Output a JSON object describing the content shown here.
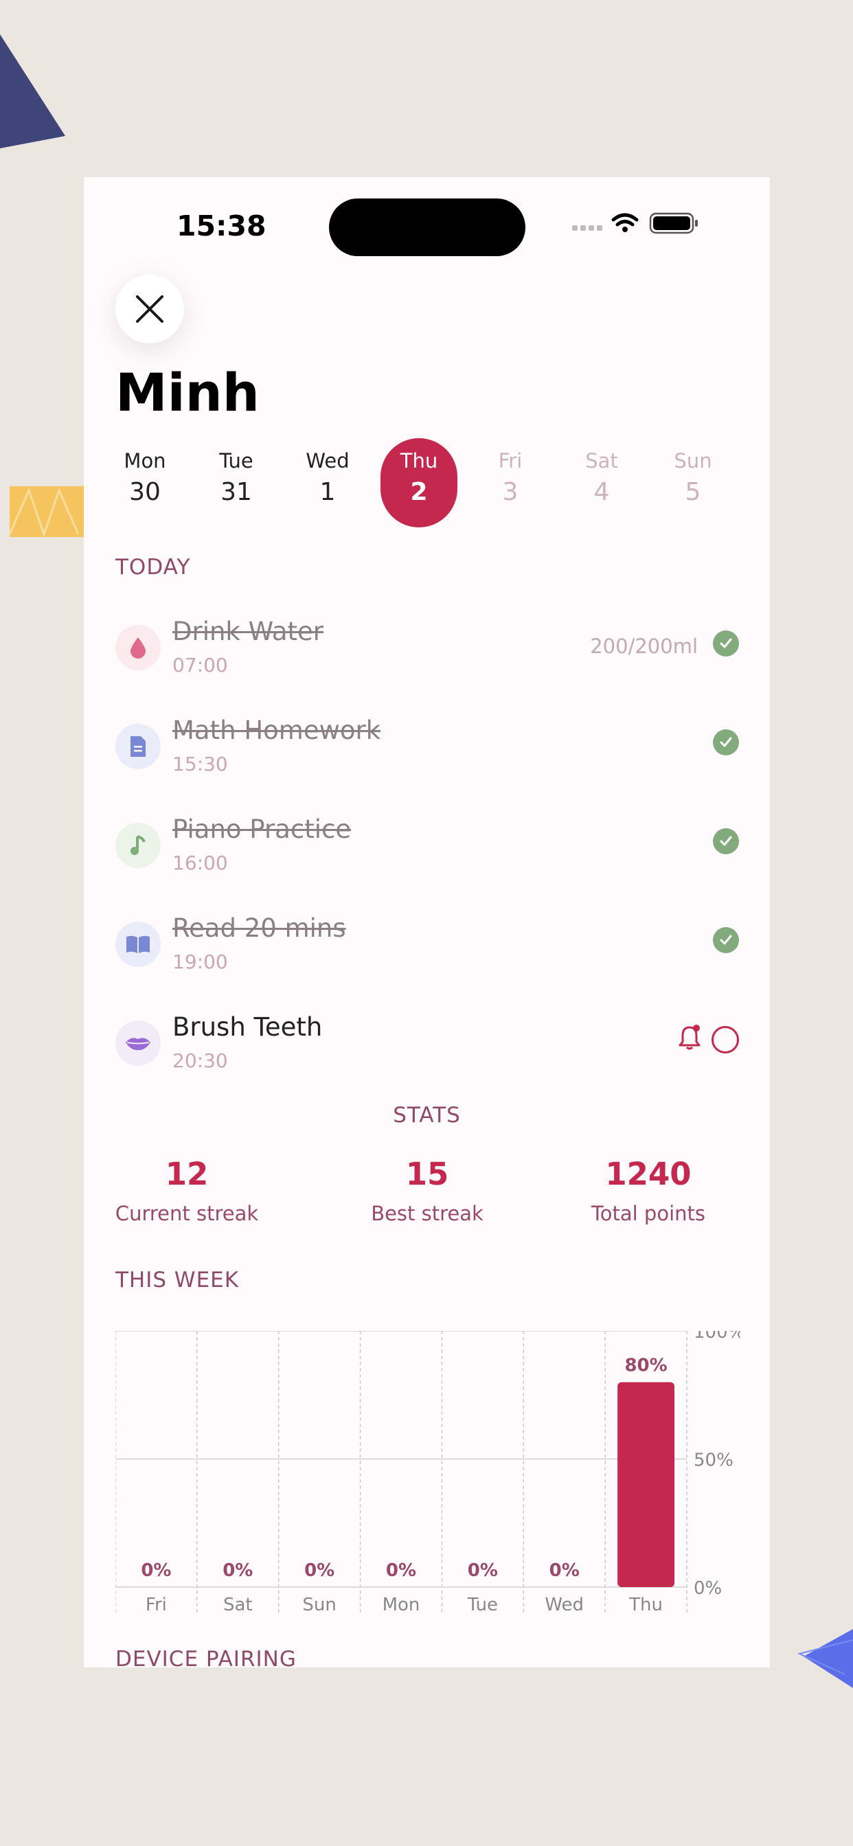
{
  "status_bar": {
    "time": "15:38"
  },
  "header": {
    "name": "Minh"
  },
  "days": [
    {
      "name": "Mon",
      "date": "30",
      "state": "past"
    },
    {
      "name": "Tue",
      "date": "31",
      "state": "past"
    },
    {
      "name": "Wed",
      "date": "1",
      "state": "past"
    },
    {
      "name": "Thu",
      "date": "2",
      "state": "active"
    },
    {
      "name": "Fri",
      "date": "3",
      "state": "future"
    },
    {
      "name": "Sat",
      "date": "4",
      "state": "future"
    },
    {
      "name": "Sun",
      "date": "5",
      "state": "future"
    }
  ],
  "today": {
    "label": "TODAY",
    "tasks": [
      {
        "name": "Drink Water",
        "time": "07:00",
        "amount": "200/200ml",
        "done": true,
        "icon": "water-drop-icon"
      },
      {
        "name": "Math Homework",
        "time": "15:30",
        "done": true,
        "icon": "document-icon"
      },
      {
        "name": "Piano Practice",
        "time": "16:00",
        "done": true,
        "icon": "music-note-icon"
      },
      {
        "name": "Read 20 mins",
        "time": "19:00",
        "done": true,
        "icon": "open-book-icon"
      },
      {
        "name": "Brush Teeth",
        "time": "20:30",
        "done": false,
        "icon": "lips-icon"
      }
    ]
  },
  "stats": {
    "label": "STATS",
    "items": [
      {
        "value": "12",
        "label": "Current streak"
      },
      {
        "value": "15",
        "label": "Best streak"
      },
      {
        "value": "1240",
        "label": "Total points"
      }
    ]
  },
  "this_week": {
    "label": "THIS WEEK"
  },
  "chart_data": {
    "type": "bar",
    "categories": [
      "Fri",
      "Sat",
      "Sun",
      "Mon",
      "Tue",
      "Wed",
      "Thu"
    ],
    "values": [
      0,
      0,
      0,
      0,
      0,
      0,
      80
    ],
    "value_labels": [
      "0%",
      "0%",
      "0%",
      "0%",
      "0%",
      "0%",
      "80%"
    ],
    "y_ticks": [
      "100%",
      "50%",
      "0%"
    ],
    "ylim": [
      0,
      100
    ],
    "grid": true,
    "bar_color": "#C4284E"
  },
  "next_section": {
    "label": "DEVICE PAIRING"
  },
  "colors": {
    "accent": "#C4284E",
    "done_green": "#83AA7C",
    "section_label": "#8E4A66",
    "background": "#ECE6E0"
  }
}
